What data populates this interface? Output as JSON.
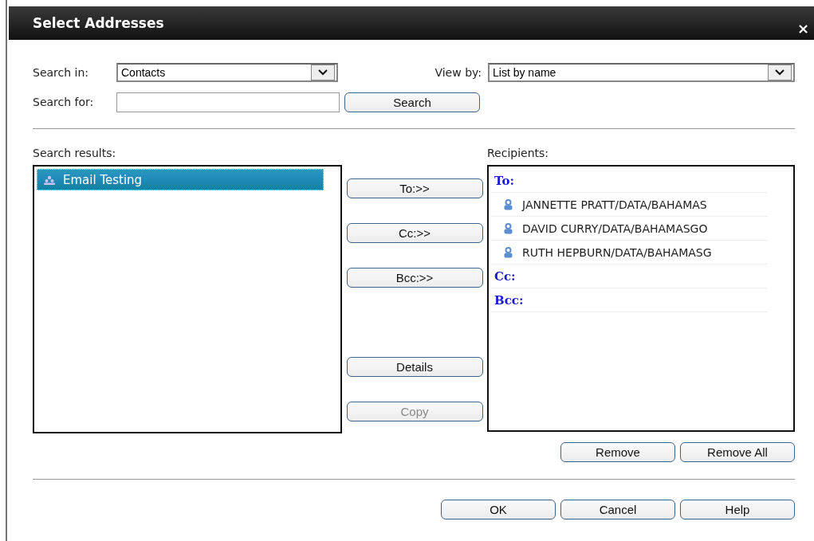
{
  "window": {
    "title": "Select Addresses",
    "close": "×"
  },
  "search_in": {
    "label": "Search in:",
    "value": "Contacts"
  },
  "view_by": {
    "label": "View by:",
    "value": "List by name"
  },
  "search_for": {
    "label": "Search for:",
    "button": "Search"
  },
  "search_results": {
    "label": "Search results:",
    "items": [
      {
        "name": "Email Testing",
        "selected": true
      }
    ]
  },
  "move_buttons": [
    {
      "label": "To:>>",
      "disabled": false
    },
    {
      "label": "Cc:>>",
      "disabled": false
    },
    {
      "label": "Bcc:>>",
      "disabled": false
    }
  ],
  "item_buttons": [
    {
      "label": "Details",
      "disabled": false
    },
    {
      "label": "Copy",
      "disabled": true
    }
  ],
  "recipients": {
    "label": "Recipients:",
    "rows": [
      {
        "kind": "header",
        "text": "To:"
      },
      {
        "kind": "contact",
        "text": "JANNETTE PRATT/DATA/BAHAMAS"
      },
      {
        "kind": "contact",
        "text": "DAVID CURRY/DATA/BAHAMASGO"
      },
      {
        "kind": "contact",
        "text": "RUTH HEPBURN/DATA/BAHAMASG"
      },
      {
        "kind": "header",
        "text": "Cc:"
      },
      {
        "kind": "header",
        "text": "Bcc:"
      }
    ]
  },
  "recipient_buttons": [
    "Remove",
    "Remove All"
  ],
  "footer_buttons": [
    "OK",
    "Cancel",
    "Help"
  ]
}
